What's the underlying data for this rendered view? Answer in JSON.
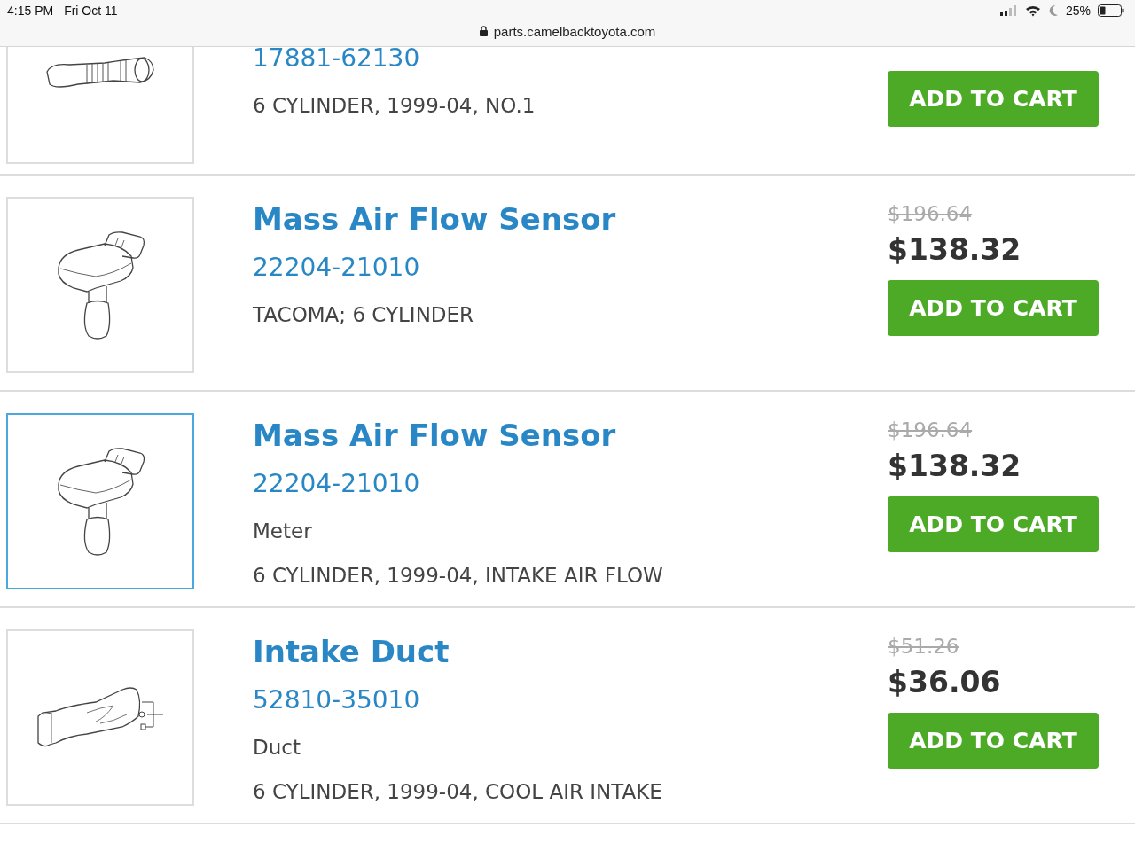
{
  "status_bar": {
    "time": "4:15 PM",
    "date": "Fri Oct 11",
    "url": "parts.camelbacktoyota.com",
    "battery": "25%"
  },
  "parts": [
    {
      "kind": "hose",
      "selected": false,
      "part_number": "17881-62130",
      "details": [
        "6 CYLINDER, 1999-04, NO.1"
      ],
      "button": "ADD TO CART"
    },
    {
      "kind": "sensor",
      "selected": false,
      "title": "Mass Air Flow Sensor",
      "part_number": "22204-21010",
      "details": [
        "TACOMA; 6 CYLINDER"
      ],
      "old_price": "$196.64",
      "price": "$138.32",
      "button": "ADD TO CART"
    },
    {
      "kind": "sensor",
      "selected": true,
      "title": "Mass Air Flow Sensor",
      "part_number": "22204-21010",
      "details": [
        "Meter",
        "6 CYLINDER, 1999-04, INTAKE AIR FLOW"
      ],
      "old_price": "$196.64",
      "price": "$138.32",
      "button": "ADD TO CART"
    },
    {
      "kind": "duct",
      "selected": false,
      "title": "Intake Duct",
      "part_number": "52810-35010",
      "details": [
        "Duct",
        "6 CYLINDER, 1999-04, COOL AIR INTAKE"
      ],
      "old_price": "$51.26",
      "price": "$36.06",
      "button": "ADD TO CART"
    }
  ]
}
